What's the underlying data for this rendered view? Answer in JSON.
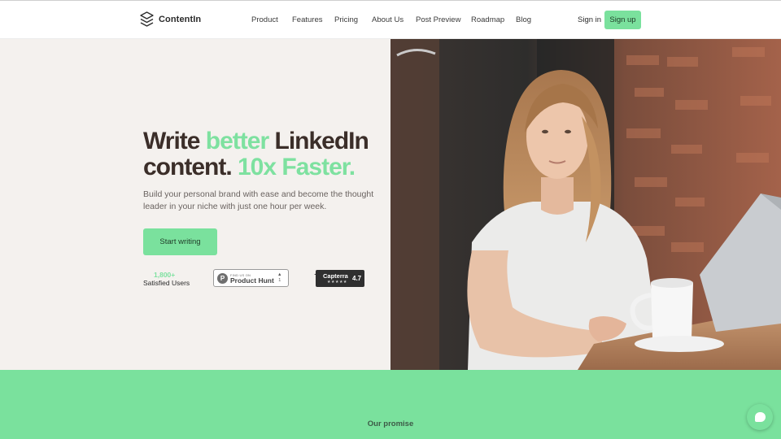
{
  "brand": {
    "name": "ContentIn",
    "logo_icon": "layers-icon"
  },
  "nav": {
    "links": [
      "Product",
      "Features",
      "Pricing",
      "About Us",
      "Post Preview",
      "Roadmap",
      "Blog"
    ],
    "signin_label": "Sign in",
    "signup_label": "Sign up"
  },
  "hero": {
    "headline_1": "Write ",
    "headline_accent_1": "better",
    "headline_2": " LinkedIn",
    "headline_3": "content. ",
    "headline_accent_2": "10x Faster.",
    "subhead": "Build your personal brand with ease and become the thought leader in your niche with just one hour per week.",
    "cta_label": "Start writing",
    "users_count": "1,800+",
    "users_label": "Satisfied Users",
    "product_hunt": {
      "small_text": "FIND US ON",
      "name": "Product Hunt",
      "vote_arrow": "▲",
      "votes": "1"
    },
    "capterra": {
      "name": "Capterra",
      "stars": "★★★★★",
      "score": "4.7"
    }
  },
  "promise": {
    "label": "Our promise"
  },
  "colors": {
    "accent": "#7ae19d",
    "headline": "#3b2e29",
    "hero_bg": "#f4f1ee"
  }
}
